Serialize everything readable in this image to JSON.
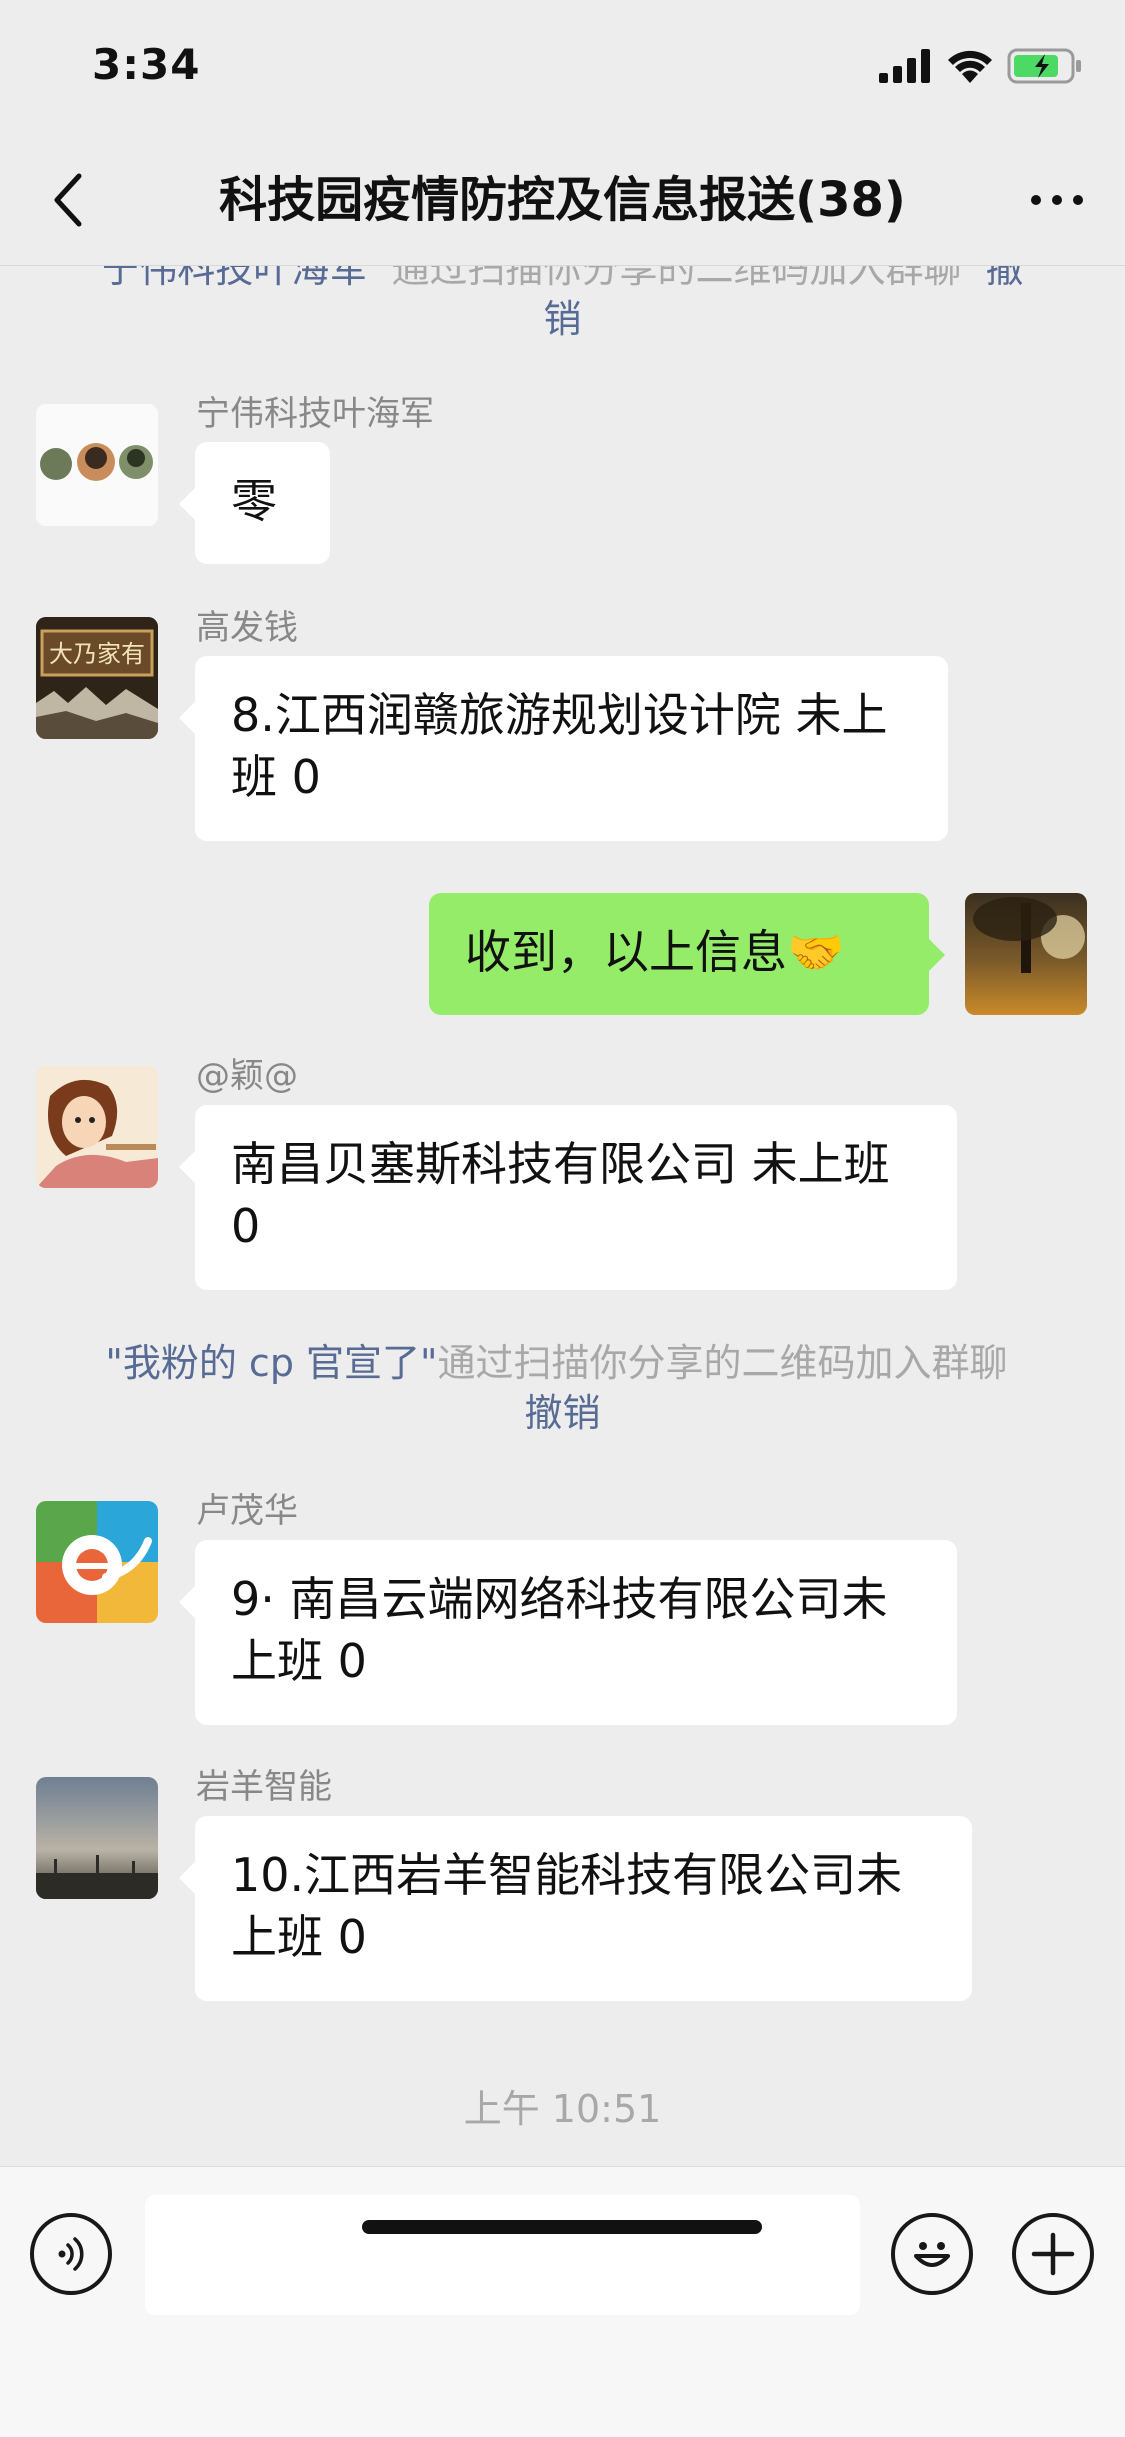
{
  "status": {
    "time": "3:34"
  },
  "nav": {
    "title": "科技园疫情防控及信息报送(38)"
  },
  "chat": {
    "sys1": {
      "user": "宁伟科技叶海军",
      "text": "通过扫描你分享的二维码加入群聊",
      "revoke": "撤销"
    },
    "messages": [
      {
        "sender": "宁伟科技叶海军",
        "text": "零"
      },
      {
        "sender": "高发钱",
        "text": "8.江西润赣旅游规划设计院 未上班 0"
      },
      {
        "text": "收到，以上信息🤝"
      },
      {
        "sender": "@颖@",
        "text": "南昌贝塞斯科技有限公司 未上班 0"
      },
      {
        "sender": "卢茂华",
        "text": "9· 南昌云端网络科技有限公司未上班 0"
      },
      {
        "sender": "岩羊智能",
        "text": "10.江西岩羊智能科技有限公司未上班 0"
      }
    ],
    "sys2": {
      "user": "\"我粉的 cp 官宣了\"",
      "text": "通过扫描你分享的二维码加入群聊",
      "revoke": "撤销"
    },
    "avatar_text": "大乃家有",
    "timestamp": "上午 10:51"
  },
  "input": {
    "voice_icon": "voice-icon",
    "emoji_icon": "emoji-icon",
    "add_icon": "plus-icon"
  },
  "colors": {
    "background": "#EDEDED",
    "my_bubble": "#95EC69",
    "link": "#576B95"
  }
}
